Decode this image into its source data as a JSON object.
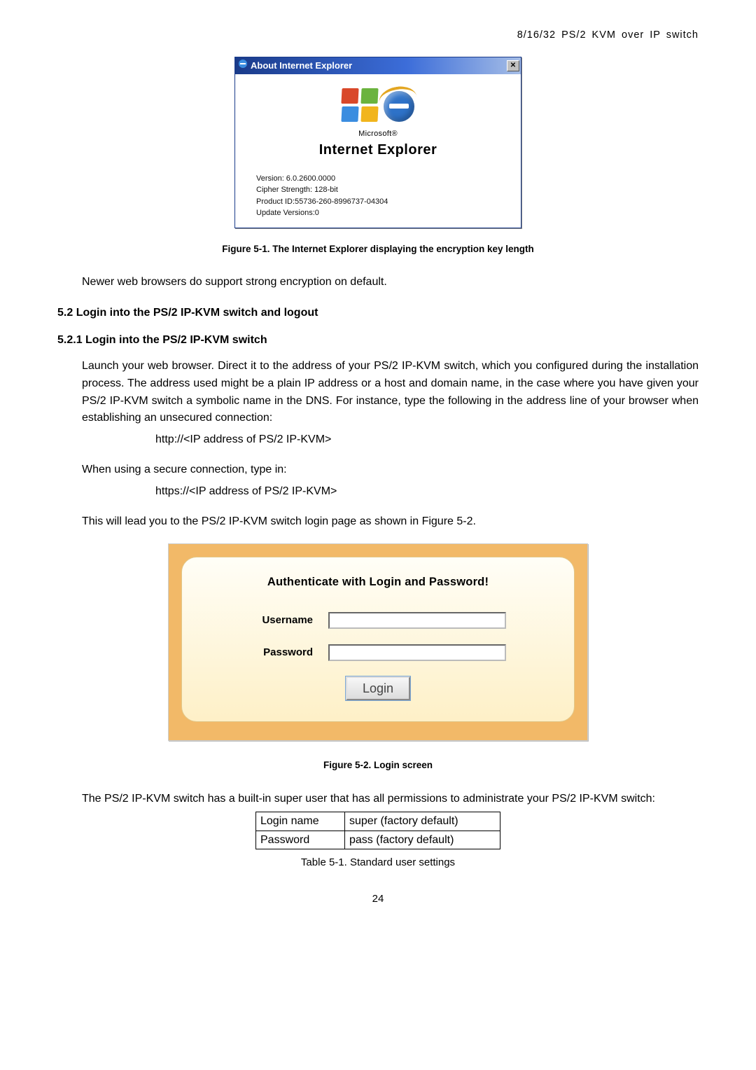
{
  "header": {
    "right": "8/16/32 PS/2 KVM over IP switch"
  },
  "ie_dialog": {
    "title": "About Internet Explorer",
    "brand_top": "Microsoft®",
    "brand_main": "Internet Explorer",
    "version": "Version: 6.0.2600.0000",
    "cipher": "Cipher Strength: 128-bit",
    "product_id": "Product ID:55736-260-8996737-04304",
    "update": "Update Versions:0"
  },
  "captions": {
    "fig1": "Figure 5-1. The Internet Explorer displaying the encryption key length",
    "fig2": "Figure 5-2. Login screen",
    "table1": "Table 5-1. Standard user settings"
  },
  "text": {
    "newer": "Newer web browsers do support strong encryption on default.",
    "h52": "5.2 Login into the PS/2 IP-KVM switch and logout",
    "h521": "5.2.1  Login into the PS/2 IP-KVM switch",
    "p_launch": "Launch your web browser. Direct it to the address of your PS/2 IP-KVM switch, which you configured during the installation process. The address used might be a plain IP address or a host and domain name, in the case where you have given your PS/2 IP-KVM switch a symbolic name in the DNS. For instance, type the following in the address line of your browser when establishing an unsecured connection:",
    "http": "http://<IP address of PS/2 IP-KVM>",
    "p_secure": "When using a secure connection, type in:",
    "https": "https://<IP address of PS/2 IP-KVM>",
    "p_lead": "This will lead you to the PS/2 IP-KVM switch login page as shown in Figure 5-2.",
    "p_builtin": "The PS/2 IP-KVM switch has a built-in super user that has all permissions to administrate your PS/2 IP-KVM switch:"
  },
  "login": {
    "auth": "Authenticate with Login and Password!",
    "username_label": "Username",
    "password_label": "Password",
    "button": "Login"
  },
  "creds": {
    "row1_label": "Login name",
    "row1_value": "super (factory default)",
    "row2_label": "Password",
    "row2_value": "pass (factory default)"
  },
  "page_number": "24"
}
